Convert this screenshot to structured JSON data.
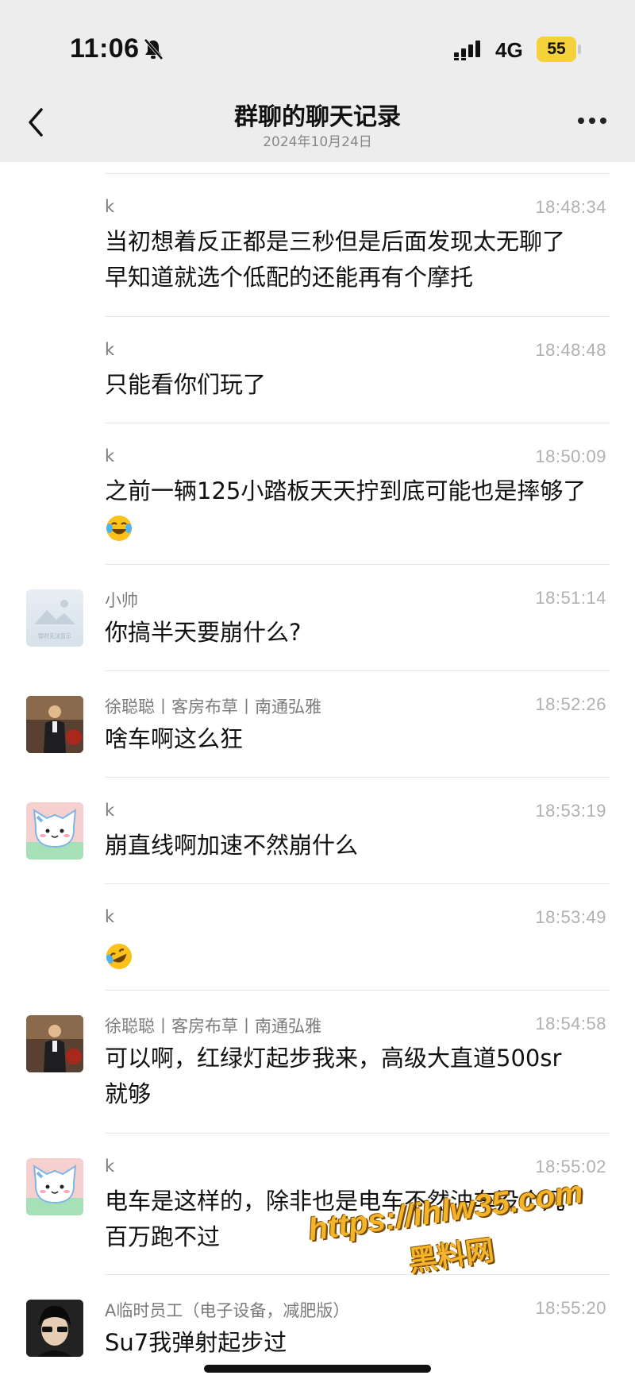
{
  "status_bar": {
    "time": "11:06",
    "network": "4G",
    "battery": "55",
    "battery_color": "#f5d23b"
  },
  "header": {
    "title": "群聊的聊天记录",
    "date": "2024年10月24日"
  },
  "messages": [
    {
      "sender": "k",
      "time": "18:48:34",
      "lines": [
        "当初想着反正都是三秒但是后面发现太无聊了",
        "早知道就选个低配的还能再有个摩托"
      ]
    },
    {
      "sender": "k",
      "time": "18:48:48",
      "lines": [
        "只能看你们玩了"
      ]
    },
    {
      "sender": "k",
      "time": "18:50:09",
      "lines": [
        "之前一辆125小踏板天天拧到底可能也是摔够了"
      ],
      "emoji": "laughing-tears"
    },
    {
      "sender": "小帅",
      "time": "18:51:14",
      "lines": [
        "你搞半天要崩什么?"
      ],
      "avatar_caption": "暂时无法显示"
    },
    {
      "sender": "徐聪聪丨客房布草丨南通弘雅",
      "time": "18:52:26",
      "lines": [
        "啥车啊这么狂"
      ]
    },
    {
      "sender": "k",
      "time": "18:53:19",
      "lines": [
        "崩直线啊加速不然崩什么"
      ]
    },
    {
      "sender": "k",
      "time": "18:53:49",
      "lines": [],
      "emoji": "rolling-laughing"
    },
    {
      "sender": "徐聪聪丨客房布草丨南通弘雅",
      "time": "18:54:58",
      "lines": [
        "可以啊，红绿灯起步我来，高级大直道500sr",
        "就够"
      ]
    },
    {
      "sender": "k",
      "time": "18:55:02",
      "lines": [
        "电车是这样的，除非也是电车不然油车没个几",
        "百万跑不过"
      ]
    },
    {
      "sender": "A临时员工（电子设备，减肥版）",
      "time": "18:55:20",
      "lines": [
        "Su7我弹射起步过"
      ]
    }
  ],
  "watermark": {
    "url": "https://ihlw35.com",
    "name": "黑料网"
  }
}
